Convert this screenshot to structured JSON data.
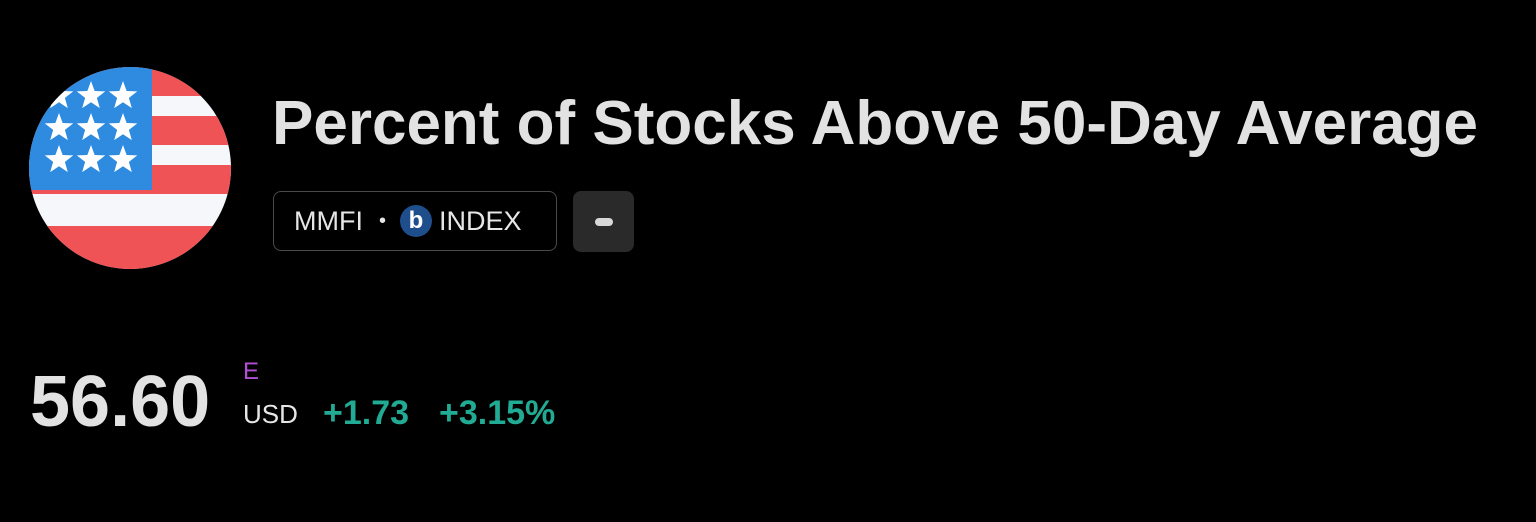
{
  "header": {
    "title": "Percent of Stocks Above 50-Day Average",
    "flag_icon": "us-flag-icon",
    "symbol": "MMFI",
    "separator": "•",
    "exchange_logo_letter": "b",
    "exchange": "INDEX"
  },
  "quote": {
    "price": "56.60",
    "estimate_marker": "E",
    "currency": "USD",
    "change": "+1.73",
    "change_percent": "+3.15%"
  },
  "colors": {
    "background": "#000000",
    "positive": "#22ab94",
    "estimate": "#b24fd4",
    "flag_blue": "#2e8be0",
    "flag_red": "#f05355",
    "flag_white": "#f5f7fb",
    "exchange_logo": "#1e4e8c"
  }
}
